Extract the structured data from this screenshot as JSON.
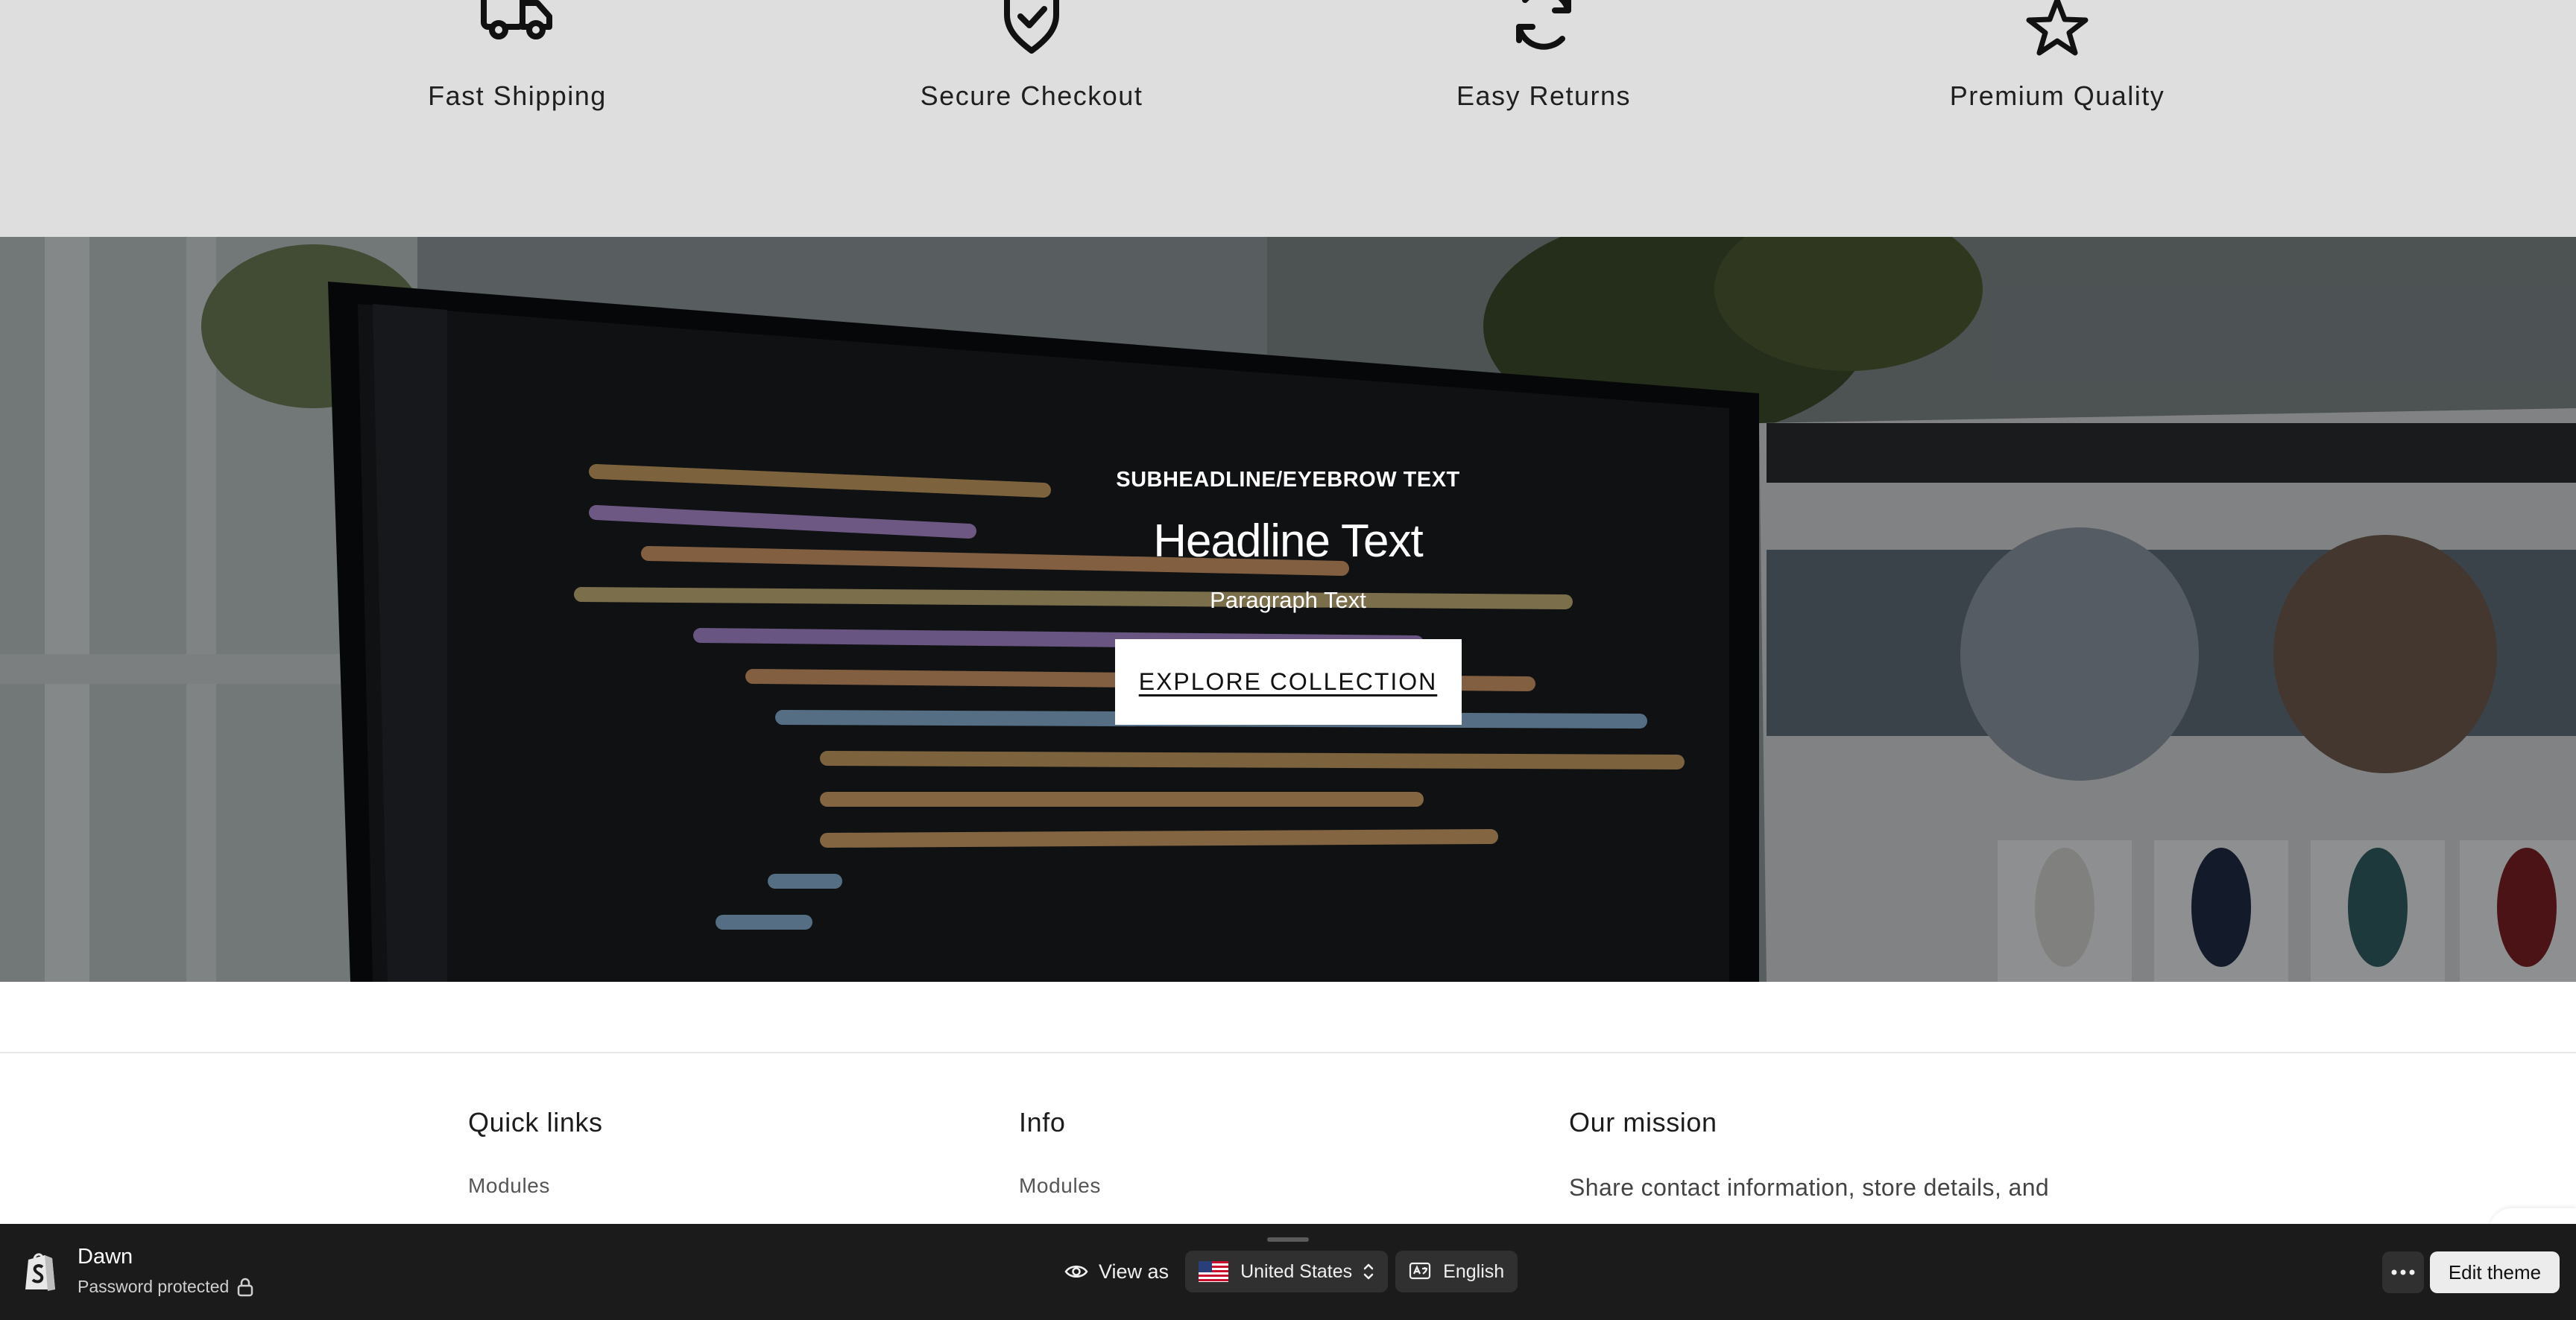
{
  "features": [
    {
      "icon": "truck-icon",
      "label": "Fast Shipping"
    },
    {
      "icon": "shield-check-icon",
      "label": "Secure Checkout"
    },
    {
      "icon": "refresh-icon",
      "label": "Easy Returns"
    },
    {
      "icon": "star-icon",
      "label": "Premium Quality"
    }
  ],
  "hero": {
    "eyebrow": "SUBHEADLINE/EYEBROW TEXT",
    "headline": "Headline Text",
    "paragraph": "Paragraph Text",
    "cta_label": "EXPLORE COLLECTION"
  },
  "footer": {
    "quick_links": {
      "heading": "Quick links",
      "links": [
        "Modules"
      ]
    },
    "info": {
      "heading": "Info",
      "links": [
        "Modules"
      ]
    },
    "mission": {
      "heading": "Our mission",
      "text": "Share contact information, store details, and"
    }
  },
  "adminbar": {
    "store_name": "Dawn",
    "status": "Password protected",
    "view_as_label": "View as",
    "country": "United States",
    "language": "English",
    "edit_label": "Edit theme"
  },
  "colors": {
    "features_bg": "#dedede",
    "adminbar_bg": "#1b1b1b",
    "cta_bg": "#ffffff"
  }
}
